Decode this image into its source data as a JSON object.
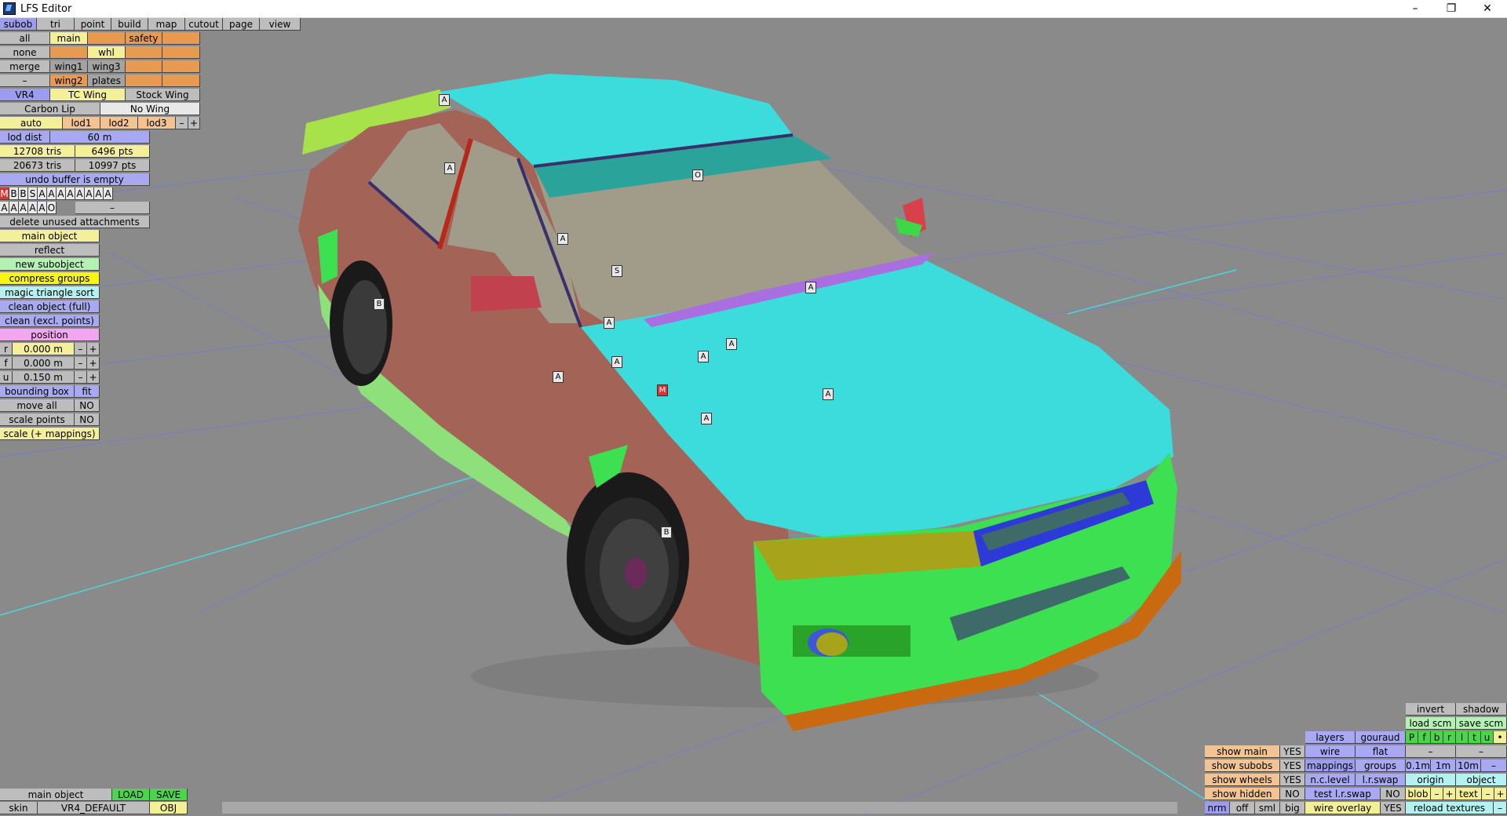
{
  "window": {
    "title": "LFS Editor",
    "minimize": "–",
    "restore": "❐",
    "close": "✕"
  },
  "menu": [
    "subob",
    "tri",
    "point",
    "build",
    "map",
    "cutout",
    "page",
    "view"
  ],
  "left": {
    "all": "all",
    "main": "main",
    "safety": "safety",
    "none": "none",
    "whl": "whl",
    "merge": "merge",
    "wing1": "wing1",
    "wing3": "wing3",
    "minus": "–",
    "wing2": "wing2",
    "plates": "plates",
    "vr4": "VR4",
    "tc_wing": "TC Wing",
    "stock_wing": "Stock Wing",
    "carbon_lip": "Carbon Lip",
    "no_wing": "No Wing",
    "auto": "auto",
    "lod1": "lod1",
    "lod2": "lod2",
    "lod3": "lod3",
    "lod_minus": "–",
    "lod_plus": "+",
    "lod_dist": "lod dist",
    "lod_dist_val": "60 m",
    "tris1": "12708 tris",
    "pts1": "6496 pts",
    "tris2": "20673 tris",
    "pts2": "10997 pts",
    "undo": "undo buffer is empty",
    "row_m": [
      "M",
      "B",
      "B",
      "S",
      "A",
      "A",
      "A",
      "A",
      "A",
      "A",
      "A",
      "A"
    ],
    "row_a": [
      "A",
      "A",
      "A",
      "A",
      "A",
      "O"
    ],
    "row_a_dash": "–",
    "delete_unused": "delete unused attachments",
    "main_object": "main object",
    "reflect": "reflect",
    "new_subobject": "new subobject",
    "compress_groups": "compress groups",
    "magic_sort": "magic triangle sort",
    "clean_full": "clean object (full)",
    "clean_excl": "clean (excl. points)",
    "position": "position",
    "pos": [
      {
        "axis": "r",
        "value": "0.000 m"
      },
      {
        "axis": "f",
        "value": "0.000 m"
      },
      {
        "axis": "u",
        "value": "0.150 m"
      }
    ],
    "pm_minus": "–",
    "pm_plus": "+",
    "bounding_box": "bounding box",
    "fit": "fit",
    "move_all": "move all",
    "move_all_val": "NO",
    "scale_points": "scale points",
    "scale_points_val": "NO",
    "scale_mappings": "scale (+ mappings)"
  },
  "bottom_left": {
    "main_object": "main object",
    "load": "LOAD",
    "save": "SAVE",
    "skin": "skin",
    "skin_val": "VR4_DEFAULT",
    "obj": "OBJ"
  },
  "bottom_right": {
    "invert": "invert",
    "shadow": "shadow",
    "load_scm": "load scm",
    "save_scm": "save scm",
    "layers": "layers",
    "gouraud": "gouraud",
    "pfbrltu": [
      "P",
      "f",
      "b",
      "r",
      "l",
      "t",
      "u"
    ],
    "dot": "•",
    "show_main": "show main",
    "show_main_val": "YES",
    "wire": "wire",
    "flat": "flat",
    "dash1": "–",
    "dash2": "–",
    "show_subobs": "show subobs",
    "show_subobs_val": "YES",
    "mappings": "mappings",
    "groups": "groups",
    "m01": "0.1m",
    "m1": "1m",
    "m10": "10m",
    "mdash": "–",
    "show_wheels": "show wheels",
    "show_wheels_val": "YES",
    "nc_level": "n.c.level",
    "lr_swap": "l.r.swap",
    "origin": "origin",
    "object": "object",
    "show_hidden": "show hidden",
    "show_hidden_val": "NO",
    "test_lr_swap": "test l.r.swap",
    "test_lr_swap_val": "NO",
    "blob": "blob",
    "blob_minus": "–",
    "blob_plus": "+",
    "text": "text",
    "text_minus": "–",
    "text_plus": "+",
    "nrm": "nrm",
    "off": "off",
    "sml": "sml",
    "big": "big",
    "wire_overlay": "wire overlay",
    "wire_overlay_val": "YES",
    "reload_textures": "reload textures",
    "rt_dash": "–"
  },
  "car_labels": [
    "A",
    "A",
    "O",
    "A",
    "S",
    "A",
    "A",
    "A",
    "A",
    "A",
    "M",
    "A",
    "A",
    "A",
    "B",
    "B"
  ],
  "colors": {
    "bg": "#8a8a8a",
    "body": "#a36356",
    "cyan": "#3cdcdc",
    "green": "#3ce050"
  }
}
